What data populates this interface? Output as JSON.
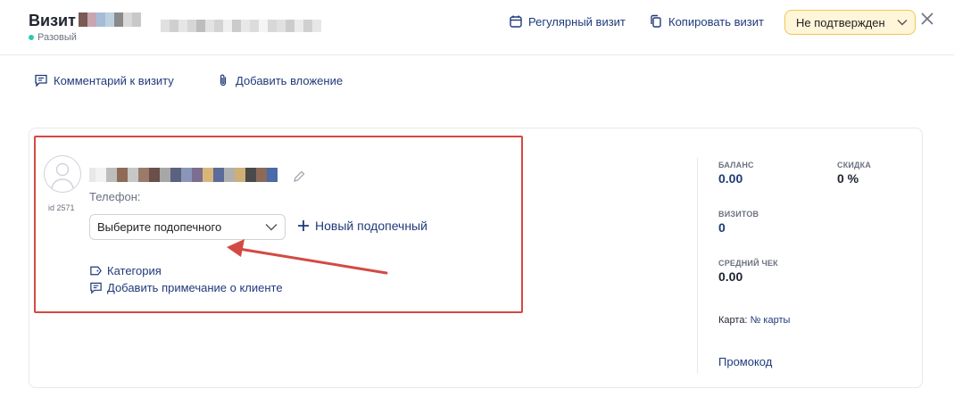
{
  "header": {
    "title": "Визит",
    "visit_type": "Разовый",
    "regular_visit_label": "Регулярный визит",
    "copy_visit_label": "Копировать визит",
    "status_value": "Не подтвержден"
  },
  "links": {
    "comment_label": "Комментарий к визиту",
    "attachment_label": "Добавить вложение"
  },
  "client": {
    "id_label": "id 2571",
    "phone_label": "Телефон:",
    "ward_select_placeholder": "Выберите подопечного",
    "new_ward_label": "Новый подопечный",
    "category_label": "Категория",
    "add_note_label": "Добавить примечание о клиенте"
  },
  "stats": {
    "balance_label": "БАЛАНС",
    "balance_value": "0.00",
    "discount_label": "СКИДКА",
    "discount_value": "0 %",
    "visits_label": "ВИЗИТОВ",
    "visits_value": "0",
    "avg_check_label": "СРЕДНИЙ ЧЕК",
    "avg_check_value": "0.00",
    "card_label": "Карта:",
    "card_number_label": "№ карты",
    "promo_label": "Промокод"
  },
  "colors": {
    "accent": "#1f3a7a",
    "status_bg": "#fff5d9",
    "status_border": "#f0c654",
    "highlight": "#d34a43",
    "dot": "#2fc6b3"
  }
}
